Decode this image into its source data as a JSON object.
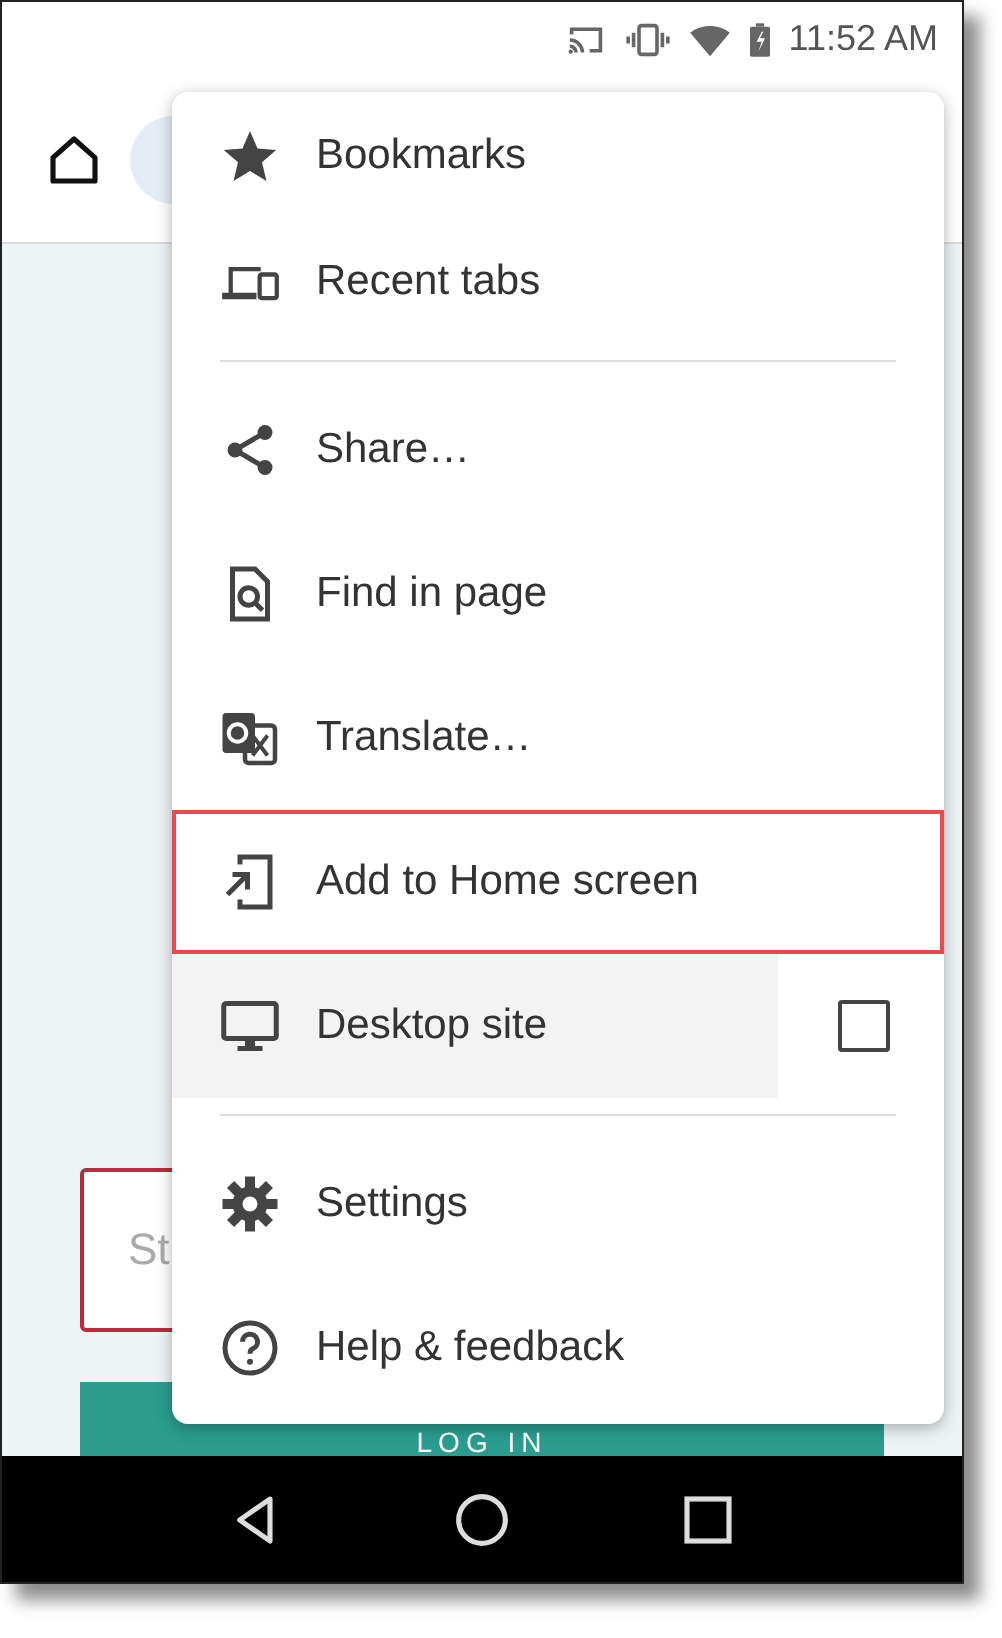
{
  "status_bar": {
    "time": "11:52 AM"
  },
  "page": {
    "input": {
      "placeholder": "St"
    },
    "login_button": "LOG IN"
  },
  "menu": {
    "items": [
      {
        "kind": "item",
        "label": "Bookmarks",
        "highlighted": false,
        "pressed": false
      },
      {
        "kind": "item",
        "label": "Recent tabs",
        "highlighted": false,
        "pressed": false
      },
      {
        "kind": "divider"
      },
      {
        "kind": "item",
        "label": "Share…",
        "highlighted": false,
        "pressed": false
      },
      {
        "kind": "item",
        "label": "Find in page",
        "highlighted": false,
        "pressed": false
      },
      {
        "kind": "item",
        "label": "Translate…",
        "highlighted": false,
        "pressed": false
      },
      {
        "kind": "item",
        "label": "Add to Home screen",
        "highlighted": true,
        "pressed": false
      },
      {
        "kind": "checkbox",
        "label": "Desktop site",
        "highlighted": false,
        "pressed": true,
        "checked": false
      },
      {
        "kind": "divider"
      },
      {
        "kind": "item",
        "label": "Settings",
        "highlighted": false,
        "pressed": false
      },
      {
        "kind": "item",
        "label": "Help & feedback",
        "highlighted": false,
        "pressed": false
      }
    ]
  }
}
